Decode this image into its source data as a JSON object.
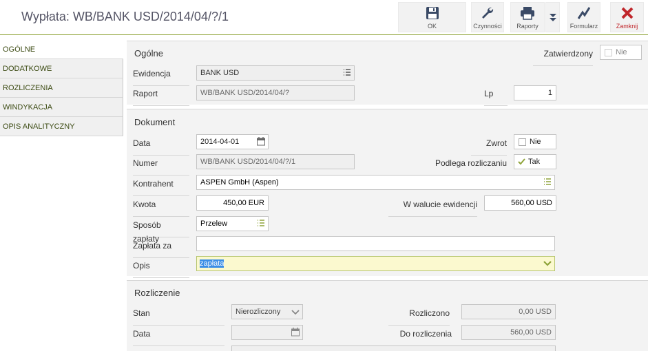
{
  "window": {
    "title": "Wypłata: WB/BANK USD/2014/04/?/1"
  },
  "toolbar": {
    "ok": "OK",
    "czynnosci": "Czynności",
    "raporty": "Raporty",
    "formularz": "Formularz",
    "zamknij": "Zamknij"
  },
  "sidebar": {
    "items": [
      "OGÓLNE",
      "DODATKOWE",
      "ROZLICZENIA",
      "WINDYKACJA",
      "OPIS ANALITYCZNY"
    ]
  },
  "ogolne": {
    "title": "Ogólne",
    "zatwierdzony_label": "Zatwierdzony",
    "zatwierdzony_value": "Nie",
    "ewidencja_label": "Ewidencja",
    "ewidencja_value": "BANK USD",
    "raport_label": "Raport",
    "raport_value": "WB/BANK USD/2014/04/?",
    "lp_label": "Lp",
    "lp_value": "1"
  },
  "dokument": {
    "title": "Dokument",
    "data_label": "Data",
    "data_value": "2014-04-01",
    "zwrot_label": "Zwrot",
    "zwrot_value": "Nie",
    "numer_label": "Numer",
    "numer_value": "WB/BANK USD/2014/04/?/1",
    "podlega_label": "Podlega rozliczaniu",
    "podlega_value": "Tak",
    "kontrahent_label": "Kontrahent",
    "kontrahent_value": "ASPEN GmbH (Aspen)",
    "kwota_label": "Kwota",
    "kwota_value": "450,00 EUR",
    "waluta_label": "W walucie ewidencji",
    "waluta_value": "560,00 USD",
    "sposob_label": "Sposób zapłaty",
    "sposob_value": "Przelew",
    "zaplata_label": "Zapłata za",
    "zaplata_value": "",
    "opis_label": "Opis",
    "opis_value": "zapłata"
  },
  "rozliczenie": {
    "title": "Rozliczenie",
    "stan_label": "Stan",
    "stan_value": "Nierozliczony",
    "rozliczono_label": "Rozliczono",
    "rozliczono_value": "0,00 USD",
    "data_label": "Data",
    "data_value": "",
    "do_rozliczenia_label": "Do rozliczenia",
    "do_rozliczenia_value": "560,00 USD"
  },
  "colors": {
    "accent": "#8fa43a",
    "close": "#c0262b",
    "toolbar_icon": "#3a4a66"
  }
}
